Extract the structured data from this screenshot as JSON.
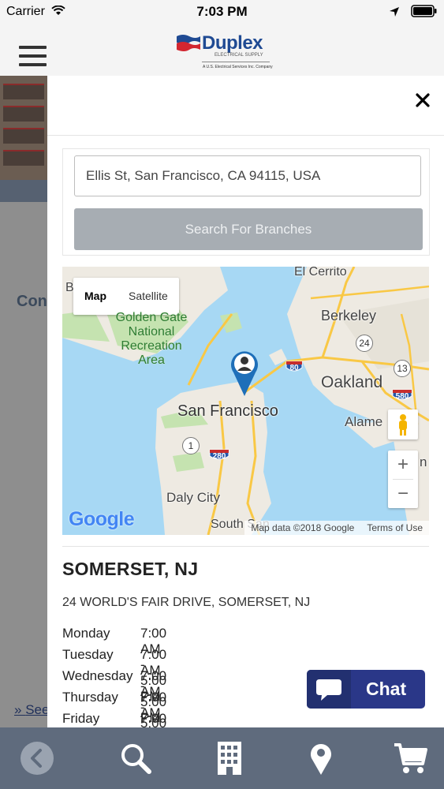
{
  "status_bar": {
    "carrier": "Carrier",
    "time": "7:03 PM"
  },
  "header": {
    "logo_text": "Duplex",
    "logo_subtitle": "ELECTRICAL SUPPLY",
    "logo_tagline": "A U.S. Electrical Services Inc. Company"
  },
  "background_page": {
    "heading_fragment": "Con",
    "see_link_fragment": "See"
  },
  "search": {
    "input_value": "Ellis St, San Francisco, CA 94115, USA",
    "button_label": "Search For Branches"
  },
  "map": {
    "type_options": [
      "Map",
      "Satellite"
    ],
    "selected_type": "Map",
    "labels": {
      "el_cerrito": "El Cerrito",
      "berkeley": "Berkeley",
      "golden_gate": "Golden Gate\nNational\nRecreation\nArea",
      "oakland": "Oakland",
      "alameda": "Alame",
      "san_francisco": "San Francisco",
      "daly_city": "Daly City",
      "south_san": "South San",
      "left_b": "B",
      "right_n": "n"
    },
    "highway_shields": [
      "80",
      "580",
      "280"
    ],
    "route_markers": [
      "24",
      "13",
      "1"
    ],
    "zoom_in": "+",
    "zoom_out": "−",
    "google_logo": "Google",
    "map_data": "Map data ©2018 Google",
    "terms": "Terms of Use",
    "colors": {
      "water": "#a7d8f4",
      "land": "#eeeae2",
      "park": "#c5e3b0",
      "road": "#f9c845",
      "pin": "#1e6fb9"
    }
  },
  "branch": {
    "name": "SOMERSET, NJ",
    "address": "24 WORLD'S FAIR DRIVE, SOMERSET, NJ",
    "hours": [
      {
        "day": "Monday",
        "time": "7:00 AM - 5:00 PM"
      },
      {
        "day": "Tuesday",
        "time": "7:00 AM - 5:00 PM"
      },
      {
        "day": "Wednesday",
        "time": "7:00 AM - 5:00 PM"
      },
      {
        "day": "Thursday",
        "time": "7:00 AM - 5:00 PM"
      },
      {
        "day": "Friday",
        "time": "7:00 AM - 5:00 PM"
      }
    ]
  },
  "chat": {
    "label": "Chat"
  },
  "bottom_nav": {
    "items": [
      "back-icon",
      "search-icon",
      "building-icon",
      "location-pin-icon",
      "cart-icon"
    ]
  }
}
